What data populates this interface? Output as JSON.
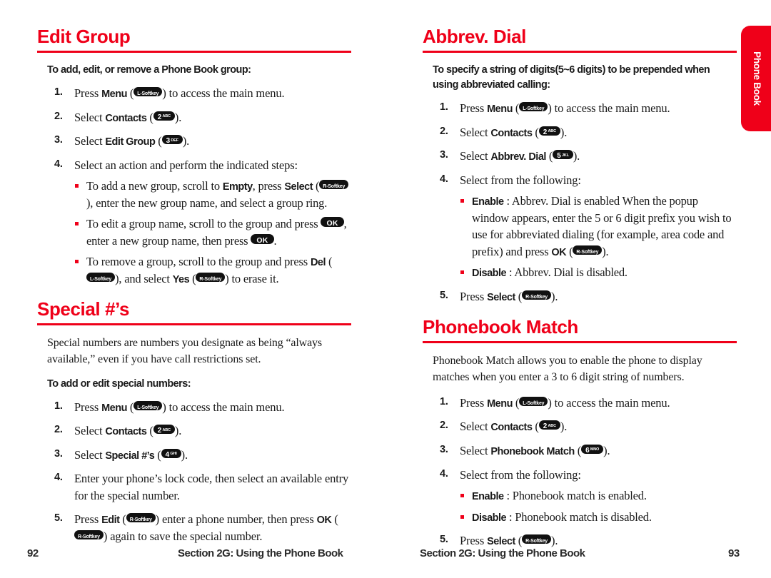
{
  "document": {
    "type": "phone-user-guide-spread",
    "accent_color": "#ef0019",
    "text_color": "#1a1a1a"
  },
  "thumb_tab": {
    "label": "Phone Book"
  },
  "footers": {
    "left_page_number": "92",
    "left_section": "Section 2G: Using the Phone Book",
    "right_section": "Section 2G: Using the Phone Book",
    "right_page_number": "93"
  },
  "keys": {
    "left_softkey": {
      "main": "L-Softkey"
    },
    "right_softkey": {
      "main": "R-Softkey"
    },
    "ok": {
      "main": "OK"
    },
    "k2": {
      "main": "2",
      "sub": "ABC"
    },
    "k3": {
      "main": "3",
      "sub": "DEF"
    },
    "k4": {
      "main": "4",
      "sub": "GHI"
    },
    "k5": {
      "main": "5",
      "sub": "JKL"
    },
    "k6": {
      "main": "6",
      "sub": "MNO"
    }
  },
  "left_column": {
    "sections": [
      {
        "title": "Edit Group",
        "lead": "To add, edit, or remove a Phone Book group:",
        "steps": {
          "n1": "1.",
          "s1_a": "Press ",
          "s1_b": "Menu",
          "s1_c": " (",
          "s1_d": ") to access the main menu.",
          "n2": "2.",
          "s2_a": "Select ",
          "s2_b": "Contacts",
          "s2_c": " (",
          "s2_d": ").",
          "n3": "3.",
          "s3_a": "Select ",
          "s3_b": "Edit Group",
          "s3_c": " (",
          "s3_d": ").",
          "n4": "4.",
          "s4_a": "Select an action and perform the indicated steps:",
          "b1_a": "To add a new group, scroll to ",
          "b1_b": "Empty",
          "b1_c": ", press ",
          "b1_d": "Select",
          "b1_e": " (",
          "b1_f": "), enter the new group name, and select a group ring.",
          "b2_a": "To edit a group name, scroll to the group and press ",
          "b2_b": ", enter a new group name, then press ",
          "b2_c": ".",
          "b3_a": "To remove a group, scroll to the group and press ",
          "b3_b": "Del",
          "b3_c": " (",
          "b3_d": "), and select ",
          "b3_e": "Yes",
          "b3_f": " (",
          "b3_g": ") to erase it."
        }
      },
      {
        "title": "Special #’s",
        "para": "Special numbers are numbers you designate as being “always available,” even if you have call restrictions set.",
        "lead": "To add or edit special numbers:",
        "steps": {
          "n1": "1.",
          "s1_a": "Press ",
          "s1_b": "Menu",
          "s1_c": " (",
          "s1_d": ") to access the main menu.",
          "n2": "2.",
          "s2_a": "Select ",
          "s2_b": "Contacts",
          "s2_c": " (",
          "s2_d": ").",
          "n3": "3.",
          "s3_a": "Select ",
          "s3_b": "Special #’s",
          "s3_c": " (",
          "s3_d": ").",
          "n4": "4.",
          "s4_a": "Enter your phone’s lock code, then select an available entry for the special number.",
          "n5": "5.",
          "s5_a": "Press ",
          "s5_b": "Edit",
          "s5_c": " (",
          "s5_d": ") enter a phone number, then press ",
          "s5_e": "OK",
          "s5_f": " (",
          "s5_g": ") again to save the special number."
        }
      }
    ]
  },
  "right_column": {
    "sections": [
      {
        "title": "Abbrev. Dial",
        "lead": "To specify a string of digits(5~6 digits) to be prepended when using abbreviated calling:",
        "steps": {
          "n1": "1.",
          "s1_a": "Press ",
          "s1_b": "Menu",
          "s1_c": " (",
          "s1_d": ") to access the main menu.",
          "n2": "2.",
          "s2_a": "Select ",
          "s2_b": "Contacts",
          "s2_c": " (",
          "s2_d": ").",
          "n3": "3.",
          "s3_a": "Select ",
          "s3_b": "Abbrev. Dial",
          "s3_c": " (",
          "s3_d": ").",
          "n4": "4.",
          "s4_a": "Select from the following:",
          "b1_a": "Enable",
          "b1_b": " : Abbrev. Dial is enabled  When the popup window appears, enter the 5 or 6 digit prefix you wish to use for abbreviated dialing (for example, area code and prefix) and press ",
          "b1_c": "OK",
          "b1_d": " (",
          "b1_e": ").",
          "b2_a": "Disable",
          "b2_b": " : Abbrev. Dial is disabled.",
          "n5": "5.",
          "s5_a": "Press ",
          "s5_b": "Select",
          "s5_c": " (",
          "s5_d": ")."
        }
      },
      {
        "title": "Phonebook Match",
        "para": "Phonebook Match allows you to enable the phone to display matches when you enter a 3 to 6 digit string of numbers.",
        "steps": {
          "n1": "1.",
          "s1_a": "Press ",
          "s1_b": "Menu",
          "s1_c": " (",
          "s1_d": ") to access the main menu.",
          "n2": "2.",
          "s2_a": "Select ",
          "s2_b": "Contacts",
          "s2_c": " (",
          "s2_d": ").",
          "n3": "3.",
          "s3_a": "Select ",
          "s3_b": "Phonebook Match",
          "s3_c": " (",
          "s3_d": ").",
          "n4": "4.",
          "s4_a": "Select from the following:",
          "b1_a": "Enable",
          "b1_b": " : Phonebook match is enabled.",
          "b2_a": "Disable",
          "b2_b": " : Phonebook match is disabled.",
          "n5": "5.",
          "s5_a": "Press ",
          "s5_b": "Select",
          "s5_c": " (",
          "s5_d": ")."
        }
      }
    ]
  }
}
